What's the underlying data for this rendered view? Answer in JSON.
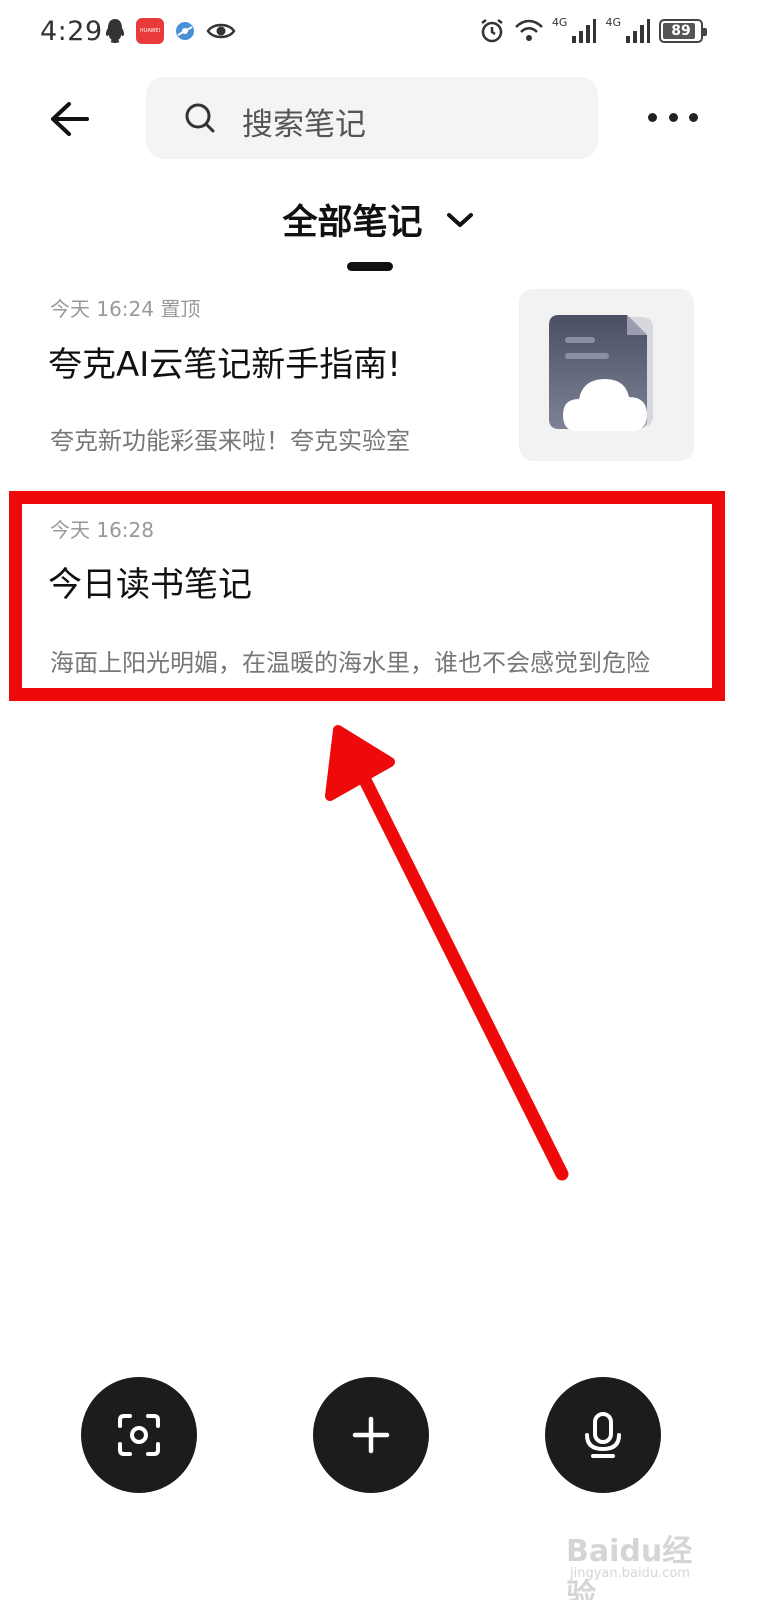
{
  "status_bar": {
    "time": "4:29",
    "huawei_label": "HUAWEI",
    "network_1": "4G",
    "network_2": "4G",
    "battery": "89",
    "battery_level": 0.89
  },
  "header": {
    "search_placeholder": "搜索笔记"
  },
  "folder": {
    "title": "全部笔记"
  },
  "notes": [
    {
      "meta": "今天 16:24 置顶",
      "title": "夸克AI云笔记新手指南!",
      "preview": "夸克新功能彩蛋来啦！夸克实验室"
    },
    {
      "meta": "今天 16:28",
      "title": "今日读书笔记",
      "preview": "海面上阳光明媚，在温暖的海水里，谁也不会感觉到危险"
    }
  ],
  "colors": {
    "highlight": "#ee0a0a",
    "fab_background": "#1c1c1c",
    "search_background": "#f4f4f4"
  },
  "icons": {
    "back": "arrow-left-icon",
    "search": "search-icon",
    "more": "more-dots-icon",
    "scan": "scan-icon",
    "add": "plus-icon",
    "voice": "microphone-icon"
  },
  "watermark": {
    "brand": "Baidu经验",
    "site": "jingyan.baidu.com"
  }
}
